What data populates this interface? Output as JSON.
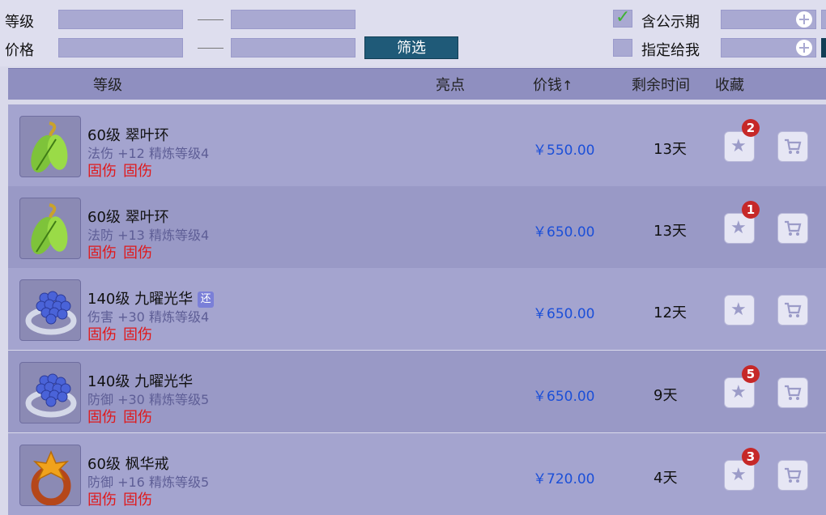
{
  "filters": {
    "level_label": "等级",
    "price_label": "价格",
    "range_separator": "——",
    "filter_button_label": "筛选",
    "include_public_label": "含公示期",
    "include_public_checked": true,
    "assigned_to_me_label": "指定给我",
    "assigned_to_me_checked": false
  },
  "table": {
    "columns": {
      "level": "等级",
      "highlight": "亮点",
      "price": "价钱",
      "price_sort_icon": "arrow-up",
      "remaining_time": "剩余时间",
      "favorite": "收藏"
    },
    "rows": [
      {
        "icon": "leaf-ring-icon",
        "name": "60级 翠叶环",
        "stat": "法伤 +12 精炼等级4",
        "tags": [
          "固伤",
          "固伤"
        ],
        "price": "￥550.00",
        "time": "13天",
        "fav_count": "2",
        "badge": ""
      },
      {
        "icon": "leaf-ring-icon",
        "name": "60级 翠叶环",
        "stat": "法防 +13 精炼等级4",
        "tags": [
          "固伤",
          "固伤"
        ],
        "price": "￥650.00",
        "time": "13天",
        "fav_count": "1",
        "badge": ""
      },
      {
        "icon": "grape-ring-icon",
        "name": "140级 九曜光华",
        "stat": "伤害 +30 精炼等级4",
        "tags": [
          "固伤",
          "固伤"
        ],
        "price": "￥650.00",
        "time": "12天",
        "fav_count": "",
        "badge": "还"
      },
      {
        "icon": "grape-ring-icon",
        "name": "140级 九曜光华",
        "stat": "防御 +30 精炼等级5",
        "tags": [
          "固伤",
          "固伤"
        ],
        "price": "￥650.00",
        "time": "9天",
        "fav_count": "5",
        "badge": ""
      },
      {
        "icon": "maple-ring-icon",
        "name": "60级 枫华戒",
        "stat": "防御 +16 精炼等级5",
        "tags": [
          "固伤",
          "固伤"
        ],
        "price": "￥720.00",
        "time": "4天",
        "fav_count": "3",
        "badge": ""
      }
    ]
  },
  "colors": {
    "price": "#1b4fd8",
    "tag": "#e0191b",
    "badge": "#c62828",
    "filter_button": "#1f5a78"
  }
}
